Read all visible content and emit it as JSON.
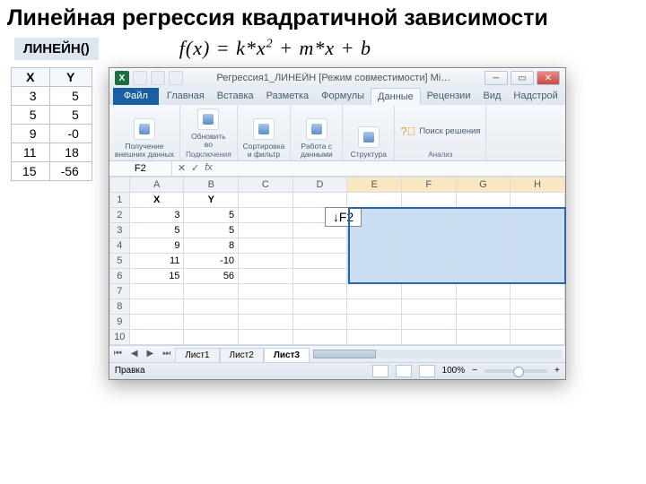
{
  "title": "Линейная регрессия квадратичной зависимости",
  "linein_label": "ЛИНЕЙН()",
  "formula_html": "f(x) = k*x<sup>2</sup> + m*x + b",
  "left_table": {
    "headers": [
      "X",
      "Y"
    ],
    "rows": [
      [
        "3",
        "5"
      ],
      [
        "5",
        "5"
      ],
      [
        "9",
        "-0"
      ],
      [
        "11",
        "18"
      ],
      [
        "15",
        "-56"
      ]
    ]
  },
  "excel": {
    "window_title": "Регрессия1_ЛИНЕЙН  [Режим совместимости]   Mi…",
    "ribbon_tabs": [
      "Главная",
      "Вставка",
      "Разметка",
      "Формулы",
      "Данные",
      "Рецензии",
      "Вид",
      "Надстрой"
    ],
    "file_tab": "Файл",
    "active_ribbon_tab": "Данные",
    "ribbon_groups": {
      "g1_label": "Получение\nвнешних данных",
      "g2_label": "Обновить\nво",
      "g2_footer": "Подключения",
      "g3_label": "Сортировка\nи фильтр",
      "g4_label": "Работа с\nданными",
      "g5_label": "Структура",
      "search_label": "Поиск решения",
      "analysis_footer": "Анализ"
    },
    "namebox": "F2",
    "callout": "↓F2",
    "columns": [
      "A",
      "B",
      "C",
      "D",
      "E",
      "F",
      "G",
      "H"
    ],
    "sheet_headers": {
      "A": "X",
      "B": "Y"
    },
    "sheet_rows": [
      {
        "r": "1",
        "A": "X",
        "B": "Y"
      },
      {
        "r": "2",
        "A": "3",
        "B": "5"
      },
      {
        "r": "3",
        "A": "5",
        "B": "5"
      },
      {
        "r": "4",
        "A": "9",
        "B": "8"
      },
      {
        "r": "5",
        "A": "11",
        "B": "-10"
      },
      {
        "r": "6",
        "A": "15",
        "B": "56"
      },
      {
        "r": "7"
      },
      {
        "r": "8"
      },
      {
        "r": "9"
      },
      {
        "r": "10"
      }
    ],
    "sheet_tabs": [
      "Лист1",
      "Лист2",
      "Лист3"
    ],
    "active_sheet": "Лист3",
    "status_text": "Правка",
    "zoom": "100%"
  }
}
